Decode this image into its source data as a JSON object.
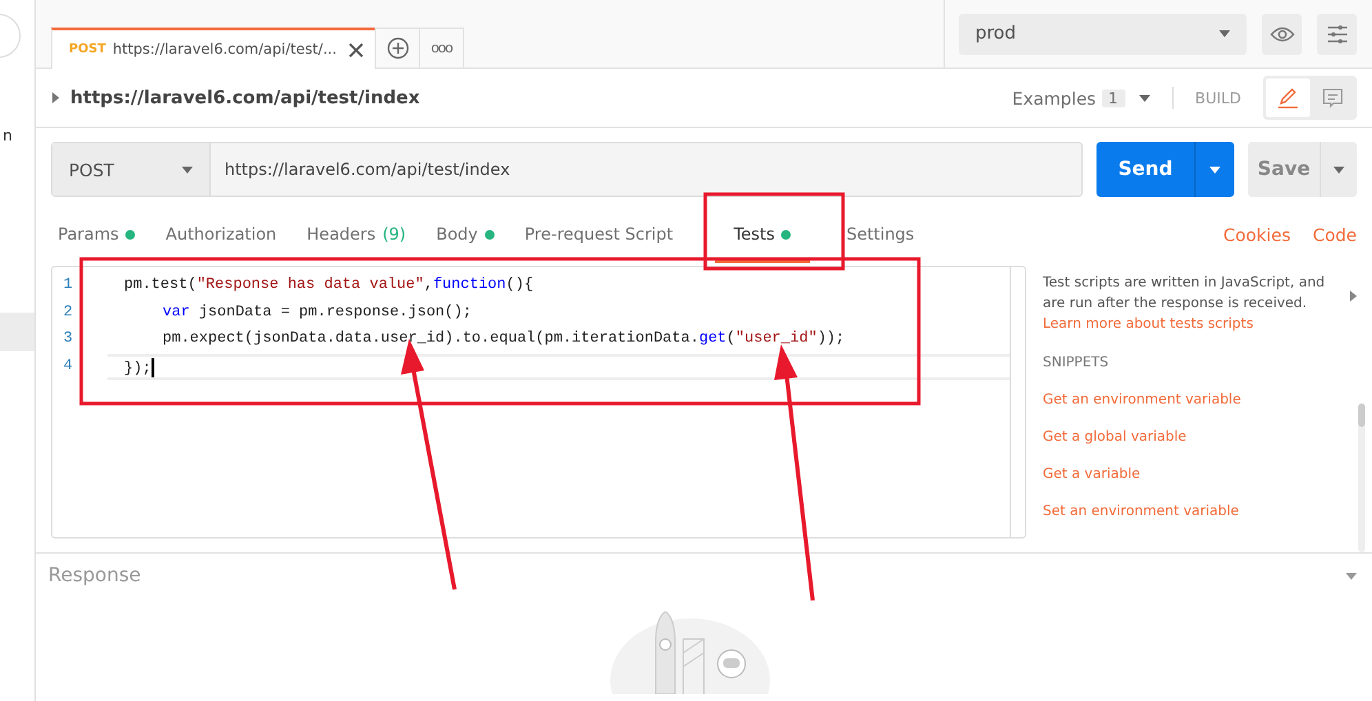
{
  "sidebar": {
    "fragment": "n"
  },
  "tab_bar": {
    "tabs": [
      {
        "method": "POST",
        "title": "https://laravel6.com/api/test/...",
        "selected": true
      }
    ],
    "more": "ooo"
  },
  "environment": {
    "value": "prod"
  },
  "request": {
    "name": "https://laravel6.com/api/test/index",
    "examples_label": "Examples",
    "examples_count": "1",
    "mode": "BUILD"
  },
  "url_bar": {
    "method": "POST",
    "url": "https://laravel6.com/api/test/index",
    "send": "Send",
    "save": "Save"
  },
  "request_tabs": [
    {
      "label": "Params",
      "dot": true,
      "selected": false
    },
    {
      "label": "Authorization",
      "dot": false,
      "selected": false
    },
    {
      "label": "Headers",
      "dot": false,
      "count": "(9)",
      "selected": false
    },
    {
      "label": "Body",
      "dot": true,
      "selected": false
    },
    {
      "label": "Pre-request Script",
      "dot": false,
      "selected": false
    },
    {
      "label": "Tests",
      "dot": true,
      "selected": true
    },
    {
      "label": "Settings",
      "dot": false,
      "selected": false
    }
  ],
  "links": [
    "Cookies",
    "Code"
  ],
  "editor": {
    "lines": [
      {
        "number": "1",
        "current": false,
        "tokens": [
          {
            "text": "pm.test(",
            "kind": "plain"
          },
          {
            "text": "\"Response has data value\"",
            "kind": "string"
          },
          {
            "text": ",",
            "kind": "plain"
          },
          {
            "text": "function",
            "kind": "keyword"
          },
          {
            "text": "(){",
            "kind": "plain"
          }
        ]
      },
      {
        "number": "2",
        "current": false,
        "indented": true,
        "tokens": [
          {
            "text": "var",
            "kind": "keyword"
          },
          {
            "text": " jsonData = pm.response.json();",
            "kind": "plain"
          }
        ]
      },
      {
        "number": "3",
        "current": false,
        "indented": true,
        "tokens": [
          {
            "text": "pm.expect(jsonData.data.user_id).to.equal(pm.iterationData.",
            "kind": "plain"
          },
          {
            "text": "get",
            "kind": "keyword"
          },
          {
            "text": "(",
            "kind": "plain"
          },
          {
            "text": "\"user_id\"",
            "kind": "string"
          },
          {
            "text": "));",
            "kind": "plain"
          }
        ]
      },
      {
        "number": "4",
        "current": true,
        "tokens": [
          {
            "text": "});",
            "kind": "plain"
          }
        ]
      }
    ]
  },
  "help": {
    "text": "Test scripts are written in JavaScript, and are run after the response is received.",
    "link": "Learn more about tests scripts",
    "snippets_title": "SNIPPETS",
    "snippets": [
      "Get an environment variable",
      "Get a global variable",
      "Get a variable",
      "Set an environment variable"
    ]
  },
  "response": {
    "title": "Response"
  }
}
